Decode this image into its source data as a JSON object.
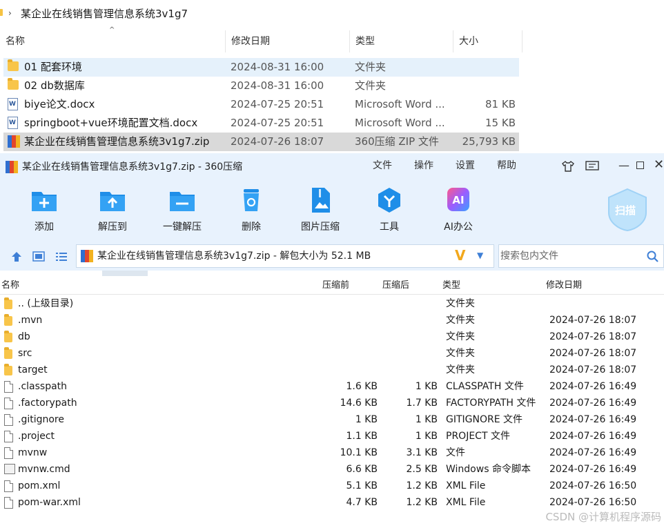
{
  "explorer": {
    "breadcrumb": "某企业在线销售管理信息系统3v1g7",
    "headers": {
      "name": "名称",
      "date": "修改日期",
      "type": "类型",
      "size": "大小"
    },
    "rows": [
      {
        "icon": "folder-icon",
        "name": "01 配套环境",
        "date": "2024-08-31 16:00",
        "type": "文件夹",
        "size": ""
      },
      {
        "icon": "folder-icon",
        "name": "02 db数据库",
        "date": "2024-08-31 16:00",
        "type": "文件夹",
        "size": ""
      },
      {
        "icon": "word-doc-icon",
        "name": "biye论文.docx",
        "date": "2024-07-25 20:51",
        "type": "Microsoft Word ...",
        "size": "81 KB"
      },
      {
        "icon": "word-doc-icon",
        "name": "springboot+vue环境配置文档.docx",
        "date": "2024-07-25 20:51",
        "type": "Microsoft Word ...",
        "size": "15 KB"
      },
      {
        "icon": "zip-archive-icon",
        "name": "某企业在线销售管理信息系统3v1g7.zip",
        "date": "2024-07-26 18:07",
        "type": "360压缩 ZIP 文件",
        "size": "25,793 KB"
      }
    ]
  },
  "app": {
    "title": "某企业在线销售管理信息系统3v1g7.zip - 360压缩",
    "menu": [
      "文件",
      "操作",
      "设置",
      "帮助"
    ],
    "toolbar": [
      {
        "label": "添加",
        "icon": "add-folder-icon"
      },
      {
        "label": "解压到",
        "icon": "extract-to-icon"
      },
      {
        "label": "一键解压",
        "icon": "quick-extract-icon"
      },
      {
        "label": "删除",
        "icon": "recycle-bin-icon"
      },
      {
        "label": "图片压缩",
        "icon": "image-compress-icon"
      },
      {
        "label": "工具",
        "icon": "tools-icon"
      },
      {
        "label": "AI办公",
        "icon": "ai-office-icon"
      }
    ],
    "scan_label": "扫描",
    "address": "某企业在线销售管理信息系统3v1g7.zip - 解包大小为 52.1 MB",
    "search_placeholder": "搜索包内文件",
    "columns": {
      "name": "名称",
      "packed": "压缩前",
      "compressed": "压缩后",
      "type": "类型",
      "modified": "修改日期"
    },
    "files": [
      {
        "icon": "folder-icon",
        "name": ".. (上级目录)",
        "size": "",
        "packed": "",
        "type": "文件夹",
        "date": ""
      },
      {
        "icon": "folder-icon",
        "name": ".mvn",
        "size": "",
        "packed": "",
        "type": "文件夹",
        "date": "2024-07-26 18:07"
      },
      {
        "icon": "folder-icon",
        "name": "db",
        "size": "",
        "packed": "",
        "type": "文件夹",
        "date": "2024-07-26 18:07"
      },
      {
        "icon": "folder-icon",
        "name": "src",
        "size": "",
        "packed": "",
        "type": "文件夹",
        "date": "2024-07-26 18:07"
      },
      {
        "icon": "folder-icon",
        "name": "target",
        "size": "",
        "packed": "",
        "type": "文件夹",
        "date": "2024-07-26 18:07"
      },
      {
        "icon": "file-icon",
        "name": ".classpath",
        "size": "1.6 KB",
        "packed": "1 KB",
        "type": "CLASSPATH 文件",
        "date": "2024-07-26 16:49"
      },
      {
        "icon": "file-icon",
        "name": ".factorypath",
        "size": "14.6 KB",
        "packed": "1.7 KB",
        "type": "FACTORYPATH 文件",
        "date": "2024-07-26 16:49"
      },
      {
        "icon": "file-icon",
        "name": ".gitignore",
        "size": "1 KB",
        "packed": "1 KB",
        "type": "GITIGNORE 文件",
        "date": "2024-07-26 16:49"
      },
      {
        "icon": "file-icon",
        "name": ".project",
        "size": "1.1 KB",
        "packed": "1 KB",
        "type": "PROJECT 文件",
        "date": "2024-07-26 16:49"
      },
      {
        "icon": "file-icon",
        "name": "mvnw",
        "size": "10.1 KB",
        "packed": "3.1 KB",
        "type": "文件",
        "date": "2024-07-26 16:49"
      },
      {
        "icon": "cmd-file-icon",
        "name": "mvnw.cmd",
        "size": "6.6 KB",
        "packed": "2.5 KB",
        "type": "Windows 命令脚本",
        "date": "2024-07-26 16:49"
      },
      {
        "icon": "file-icon",
        "name": "pom.xml",
        "size": "5.1 KB",
        "packed": "1.2 KB",
        "type": "XML File",
        "date": "2024-07-26 16:50"
      },
      {
        "icon": "file-icon",
        "name": "pom-war.xml",
        "size": "4.7 KB",
        "packed": "1.2 KB",
        "type": "XML File",
        "date": "2024-07-26 16:50"
      }
    ]
  },
  "watermark": "CSDN @计算机程序源码"
}
